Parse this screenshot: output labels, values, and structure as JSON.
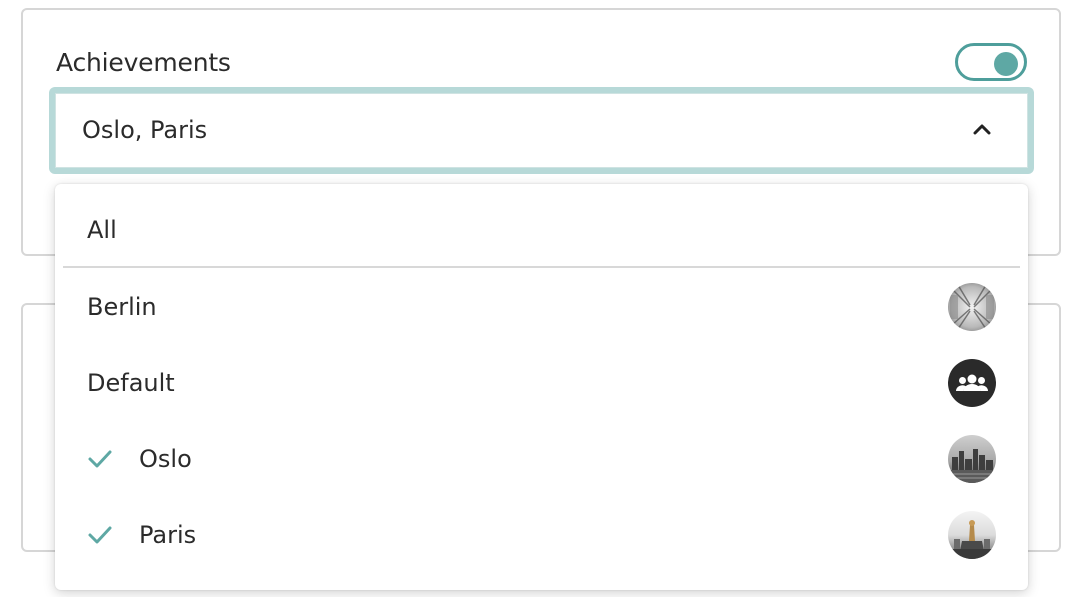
{
  "section": {
    "title": "Achievements",
    "toggle_on": true
  },
  "select": {
    "value": "Oslo, Paris",
    "expanded": true
  },
  "dropdown": {
    "all_label": "All",
    "options": [
      {
        "label": "Berlin",
        "checked": false,
        "avatar": "berlin-photo"
      },
      {
        "label": "Default",
        "checked": false,
        "avatar": "group-icon"
      },
      {
        "label": "Oslo",
        "checked": true,
        "avatar": "oslo-photo"
      },
      {
        "label": "Paris",
        "checked": true,
        "avatar": "paris-photo"
      }
    ]
  },
  "colors": {
    "accent": "#5ea8a4",
    "focus_ring": "#b7d9d8",
    "border": "#d6d6d6"
  }
}
